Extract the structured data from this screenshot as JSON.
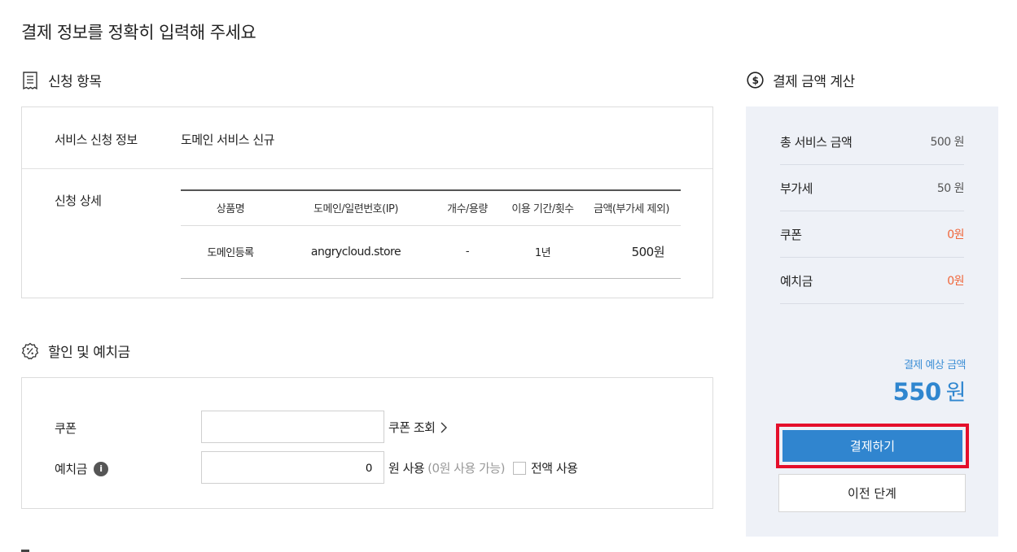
{
  "page": {
    "title": "결제 정보를 정확히 입력해 주세요"
  },
  "application": {
    "section_title": "신청 항목",
    "section_icon": "receipt-icon",
    "service_info_label": "서비스 신청 정보",
    "service_info_value": "도메인 서비스 신규",
    "detail_label": "신청 상세",
    "table": {
      "headers": [
        "상품명",
        "도메인/일련번호(IP)",
        "개수/용량",
        "이용 기간/횟수",
        "금액(부가세 제외)"
      ],
      "rows": [
        [
          "도메인등록",
          "angrycloud.store",
          "-",
          "1년",
          "500원"
        ]
      ]
    }
  },
  "discount": {
    "section_title": "할인 및 예치금",
    "section_icon": "discount-badge-icon",
    "coupon_label": "쿠폰",
    "coupon_value": "",
    "coupon_lookup": "쿠폰 조회",
    "deposit_label": "예치금",
    "deposit_info_icon": "info-icon",
    "deposit_value": "0",
    "deposit_unit": "원 사용",
    "deposit_available": "(0원 사용 가능)",
    "use_all_label": "전액 사용"
  },
  "summary": {
    "section_title": "결제 금액 계산",
    "section_icon": "dollar-circle-icon",
    "rows": [
      {
        "label": "총 서비스 금액",
        "value": "500 원"
      },
      {
        "label": "부가세",
        "value": "50 원"
      },
      {
        "label": "쿠폰",
        "value": "0원"
      },
      {
        "label": "예치금",
        "value": "0원"
      }
    ],
    "expected_label": "결제 예상 금액",
    "expected_amount": "550",
    "expected_unit": "원",
    "pay_button": "결제하기",
    "prev_button": "이전 단계"
  },
  "colors": {
    "accent_blue": "#3085cf",
    "highlight_red": "#e40f2b",
    "discount_orange": "#f0663a",
    "panel_bg": "#eef1f7"
  }
}
